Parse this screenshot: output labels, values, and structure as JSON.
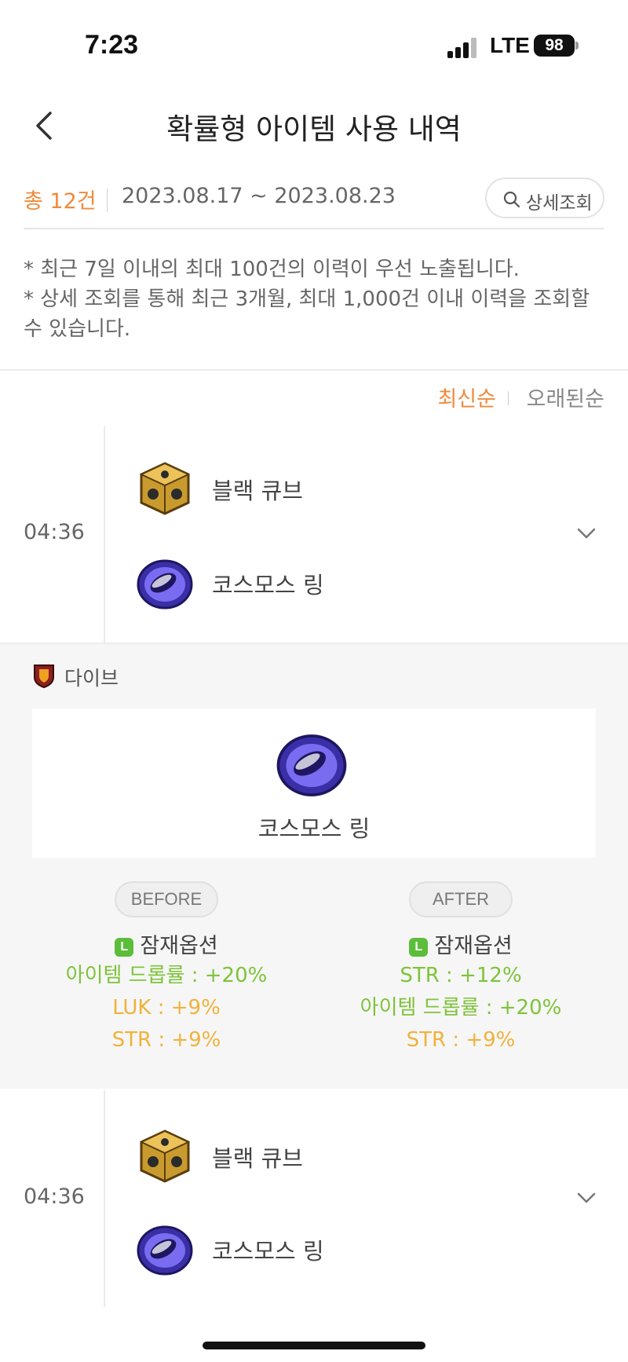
{
  "status_bar": {
    "time": "7:23",
    "network": "LTE",
    "battery": "98"
  },
  "header": {
    "title": "확률형 아이템 사용 내역"
  },
  "summary": {
    "total": "총 12건",
    "date_range": "2023.08.17 ~ 2023.08.23",
    "detail_search_label": "상세조회"
  },
  "notices": [
    "* 최근 7일 이내의 최대 100건의 이력이 우선 노출됩니다.",
    "* 상세 조회를 통해 최근 3개월, 최대 1,000건 이내 이력을 조회할 수 있습니다."
  ],
  "sort": {
    "newest": "최신순",
    "oldest": "오래된순",
    "active": "newest"
  },
  "entries": [
    {
      "time": "04:36",
      "used_item": "블랙 큐브",
      "target_item": "코스모스 링"
    },
    {
      "time": "04:36",
      "used_item": "블랙 큐브",
      "target_item": "코스모스 링"
    }
  ],
  "detail": {
    "character": "다이브",
    "item_name": "코스모스 링",
    "before": {
      "label": "BEFORE",
      "option_header": "잠재옵션",
      "grade_badge": "L",
      "options": [
        {
          "text": "아이템 드롭률 : +20%",
          "color": "green"
        },
        {
          "text": "LUK : +9%",
          "color": "yellow"
        },
        {
          "text": "STR : +9%",
          "color": "yellow"
        }
      ]
    },
    "after": {
      "label": "AFTER",
      "option_header": "잠재옵션",
      "grade_badge": "L",
      "options": [
        {
          "text": "STR : +12%",
          "color": "green"
        },
        {
          "text": "아이템 드롭률 : +20%",
          "color": "green"
        },
        {
          "text": "STR : +9%",
          "color": "yellow"
        }
      ]
    }
  },
  "colors": {
    "accent": "#f08a3c",
    "option_green": "#7ec33a",
    "option_yellow": "#f0b23a",
    "legendary_badge": "#5cbd3a"
  }
}
